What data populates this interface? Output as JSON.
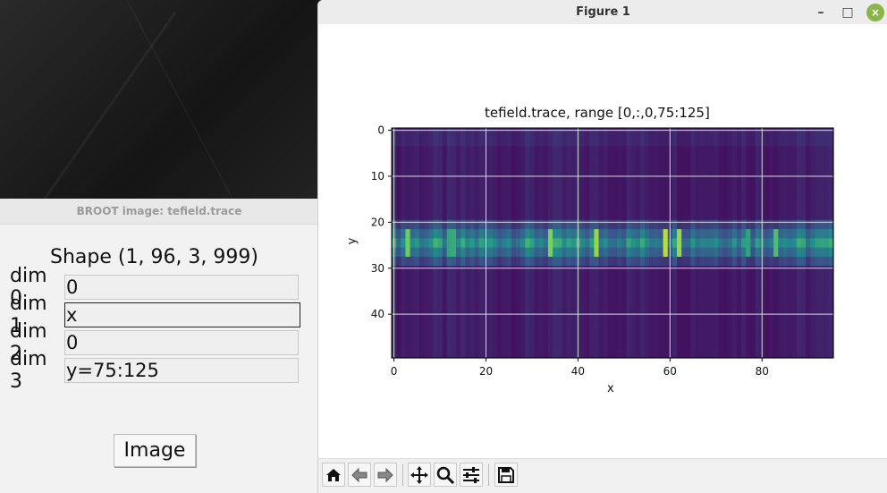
{
  "broot": {
    "title": "BROOT image: tefield.trace",
    "shape": "Shape (1, 96, 3, 999)",
    "dims": [
      {
        "label": "dim 0",
        "value": "0"
      },
      {
        "label": "dim 1",
        "value": "x"
      },
      {
        "label": "dim 2",
        "value": "0"
      },
      {
        "label": "dim 3",
        "value": "y=75:125"
      }
    ],
    "image_button": "Image"
  },
  "figure": {
    "title": "Figure 1",
    "window_buttons": {
      "minimize": "–",
      "maximize": "□",
      "close": "×"
    },
    "toolbar_icons": [
      "home-icon",
      "back-arrow-icon",
      "forward-arrow-icon",
      "pan-move-icon",
      "zoom-magnifier-icon",
      "configure-subplots-icon",
      "save-floppy-icon"
    ]
  },
  "chart_data": {
    "type": "heatmap",
    "title": "tefield.trace, range [0,:,0,75:125]",
    "xlabel": "x",
    "ylabel": "y",
    "x_ticks": [
      "0",
      "20",
      "40",
      "60",
      "80"
    ],
    "y_ticks": [
      "0",
      "10",
      "20",
      "30",
      "40"
    ],
    "xlim": [
      0,
      96
    ],
    "ylim": [
      50,
      0
    ],
    "grid": true,
    "colormap": "viridis",
    "colors": {
      "low": "#440154",
      "mid": "#31688e",
      "high": "#fde725"
    },
    "bright_columns": [
      3,
      12,
      13,
      34,
      44,
      59,
      62,
      77,
      83
    ],
    "band_rows": [
      21,
      30
    ]
  }
}
